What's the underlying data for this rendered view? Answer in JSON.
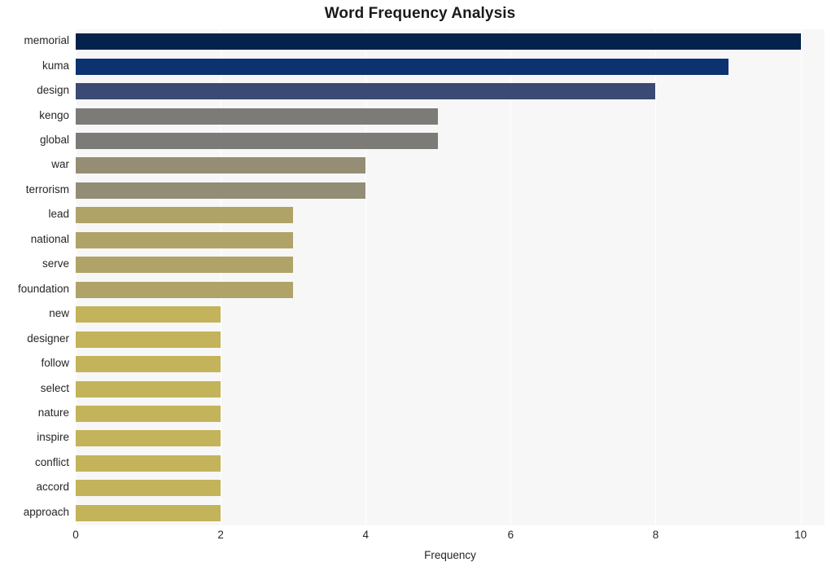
{
  "chart_data": {
    "type": "bar",
    "orientation": "horizontal",
    "title": "Word Frequency Analysis",
    "xlabel": "Frequency",
    "ylabel": "",
    "xlim": [
      0,
      10.33
    ],
    "ylim": [
      0,
      20
    ],
    "grid": "vertical-white-gridlines",
    "legend": "none",
    "plot_background": "#f7f7f7",
    "xticks": [
      "0",
      "2",
      "4",
      "6",
      "8",
      "10"
    ],
    "xtick_values": [
      0,
      2,
      4,
      6,
      8,
      10
    ],
    "categories": [
      "memorial",
      "kuma",
      "design",
      "kengo",
      "global",
      "war",
      "terrorism",
      "lead",
      "national",
      "serve",
      "foundation",
      "new",
      "designer",
      "follow",
      "select",
      "nature",
      "inspire",
      "conflict",
      "accord",
      "approach"
    ],
    "values": [
      10,
      9,
      8,
      5,
      5,
      4,
      4,
      3,
      3,
      3,
      3,
      2,
      2,
      2,
      2,
      2,
      2,
      2,
      2,
      2
    ],
    "bar_colors": [
      "#05224c",
      "#0c3270",
      "#3b4a72",
      "#7d7b78",
      "#7d7b78",
      "#958e75",
      "#948d76",
      "#b0a368",
      "#b0a368",
      "#b0a368",
      "#b0a368",
      "#c3b35a",
      "#c3b35a",
      "#c3b35a",
      "#c3b35a",
      "#c3b35a",
      "#c3b35a",
      "#c3b35a",
      "#c3b35a",
      "#c3b35a"
    ]
  }
}
